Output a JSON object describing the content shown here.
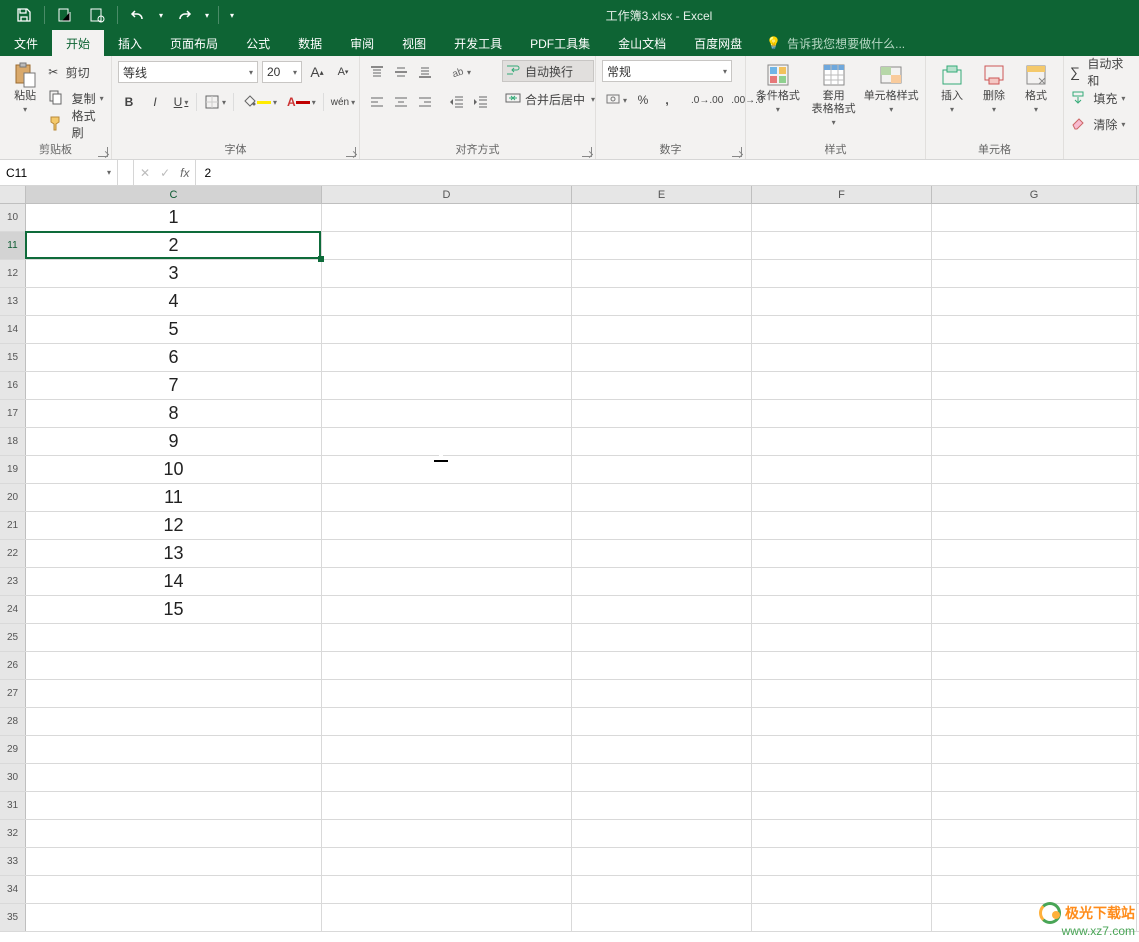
{
  "title": "工作簿3.xlsx - Excel",
  "tabs": {
    "file": "文件",
    "home": "开始",
    "insert": "插入",
    "layout": "页面布局",
    "formulas": "公式",
    "data": "数据",
    "review": "审阅",
    "view": "视图",
    "dev": "开发工具",
    "pdf": "PDF工具集",
    "wps": "金山文档",
    "baidu": "百度网盘"
  },
  "tell_me": "告诉我您想要做什么...",
  "ribbon": {
    "clipboard": {
      "label": "剪贴板",
      "paste": "粘贴",
      "cut": "剪切",
      "copy": "复制",
      "painter": "格式刷"
    },
    "font": {
      "label": "字体",
      "name": "等线",
      "size": "20",
      "increase": "A",
      "decrease": "A",
      "bold": "B",
      "italic": "I",
      "underline": "U",
      "phonetic": "wén"
    },
    "align": {
      "label": "对齐方式",
      "wrap": "自动换行",
      "merge": "合并后居中"
    },
    "number": {
      "label": "数字",
      "format": "常规"
    },
    "styles": {
      "label": "样式",
      "cond": "条件格式",
      "table": "套用\n表格格式",
      "cell": "单元格样式"
    },
    "cells": {
      "label": "单元格",
      "insert": "插入",
      "delete": "删除",
      "format": "格式"
    },
    "editing": {
      "label": "",
      "autosum": "自动求和",
      "fill": "填充",
      "clear": "清除"
    }
  },
  "namebox": "C11",
  "formula": "2",
  "columns": [
    "C",
    "D",
    "E",
    "F",
    "G"
  ],
  "rows": [
    {
      "r": "10",
      "c": "1"
    },
    {
      "r": "11",
      "c": "2"
    },
    {
      "r": "12",
      "c": "3"
    },
    {
      "r": "13",
      "c": "4"
    },
    {
      "r": "14",
      "c": "5"
    },
    {
      "r": "15",
      "c": "6"
    },
    {
      "r": "16",
      "c": "7"
    },
    {
      "r": "17",
      "c": "8"
    },
    {
      "r": "18",
      "c": "9"
    },
    {
      "r": "19",
      "c": "10"
    },
    {
      "r": "20",
      "c": "11"
    },
    {
      "r": "21",
      "c": "12"
    },
    {
      "r": "22",
      "c": "13"
    },
    {
      "r": "23",
      "c": "14"
    },
    {
      "r": "24",
      "c": "15"
    },
    {
      "r": "25",
      "c": ""
    },
    {
      "r": "26",
      "c": ""
    },
    {
      "r": "27",
      "c": ""
    },
    {
      "r": "28",
      "c": ""
    },
    {
      "r": "29",
      "c": ""
    },
    {
      "r": "30",
      "c": ""
    },
    {
      "r": "31",
      "c": ""
    },
    {
      "r": "32",
      "c": ""
    },
    {
      "r": "33",
      "c": ""
    },
    {
      "r": "34",
      "c": ""
    },
    {
      "r": "35",
      "c": ""
    }
  ],
  "selected_row_index": 1,
  "selected_col_index": 0,
  "watermark": {
    "brand": "极光下载站",
    "url": "www.xz7.com"
  }
}
